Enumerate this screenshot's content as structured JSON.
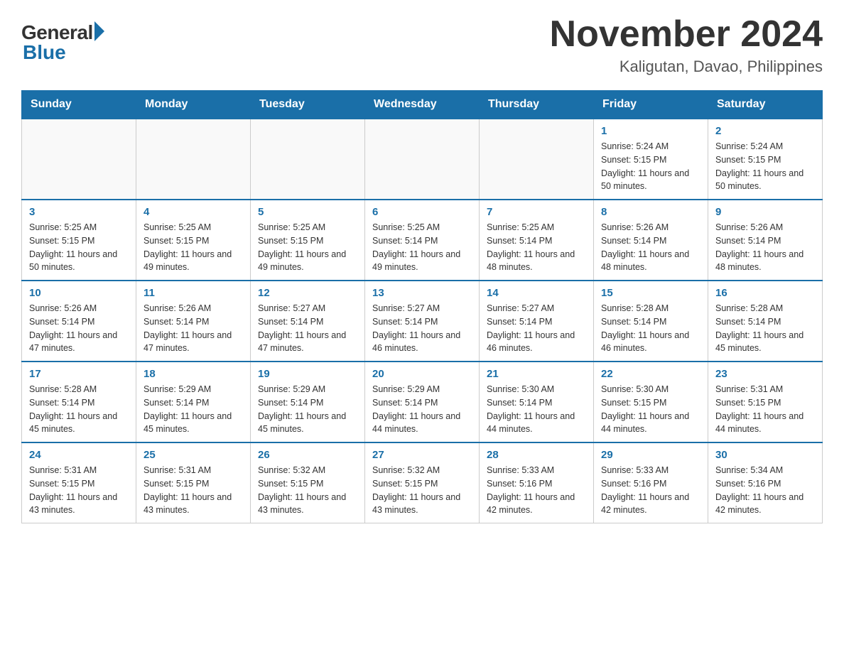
{
  "header": {
    "logo_general": "General",
    "logo_blue": "Blue",
    "month_year": "November 2024",
    "location": "Kaligutan, Davao, Philippines"
  },
  "days_of_week": [
    "Sunday",
    "Monday",
    "Tuesday",
    "Wednesday",
    "Thursday",
    "Friday",
    "Saturday"
  ],
  "weeks": [
    [
      {
        "day": "",
        "sunrise": "",
        "sunset": "",
        "daylight": ""
      },
      {
        "day": "",
        "sunrise": "",
        "sunset": "",
        "daylight": ""
      },
      {
        "day": "",
        "sunrise": "",
        "sunset": "",
        "daylight": ""
      },
      {
        "day": "",
        "sunrise": "",
        "sunset": "",
        "daylight": ""
      },
      {
        "day": "",
        "sunrise": "",
        "sunset": "",
        "daylight": ""
      },
      {
        "day": "1",
        "sunrise": "Sunrise: 5:24 AM",
        "sunset": "Sunset: 5:15 PM",
        "daylight": "Daylight: 11 hours and 50 minutes."
      },
      {
        "day": "2",
        "sunrise": "Sunrise: 5:24 AM",
        "sunset": "Sunset: 5:15 PM",
        "daylight": "Daylight: 11 hours and 50 minutes."
      }
    ],
    [
      {
        "day": "3",
        "sunrise": "Sunrise: 5:25 AM",
        "sunset": "Sunset: 5:15 PM",
        "daylight": "Daylight: 11 hours and 50 minutes."
      },
      {
        "day": "4",
        "sunrise": "Sunrise: 5:25 AM",
        "sunset": "Sunset: 5:15 PM",
        "daylight": "Daylight: 11 hours and 49 minutes."
      },
      {
        "day": "5",
        "sunrise": "Sunrise: 5:25 AM",
        "sunset": "Sunset: 5:15 PM",
        "daylight": "Daylight: 11 hours and 49 minutes."
      },
      {
        "day": "6",
        "sunrise": "Sunrise: 5:25 AM",
        "sunset": "Sunset: 5:14 PM",
        "daylight": "Daylight: 11 hours and 49 minutes."
      },
      {
        "day": "7",
        "sunrise": "Sunrise: 5:25 AM",
        "sunset": "Sunset: 5:14 PM",
        "daylight": "Daylight: 11 hours and 48 minutes."
      },
      {
        "day": "8",
        "sunrise": "Sunrise: 5:26 AM",
        "sunset": "Sunset: 5:14 PM",
        "daylight": "Daylight: 11 hours and 48 minutes."
      },
      {
        "day": "9",
        "sunrise": "Sunrise: 5:26 AM",
        "sunset": "Sunset: 5:14 PM",
        "daylight": "Daylight: 11 hours and 48 minutes."
      }
    ],
    [
      {
        "day": "10",
        "sunrise": "Sunrise: 5:26 AM",
        "sunset": "Sunset: 5:14 PM",
        "daylight": "Daylight: 11 hours and 47 minutes."
      },
      {
        "day": "11",
        "sunrise": "Sunrise: 5:26 AM",
        "sunset": "Sunset: 5:14 PM",
        "daylight": "Daylight: 11 hours and 47 minutes."
      },
      {
        "day": "12",
        "sunrise": "Sunrise: 5:27 AM",
        "sunset": "Sunset: 5:14 PM",
        "daylight": "Daylight: 11 hours and 47 minutes."
      },
      {
        "day": "13",
        "sunrise": "Sunrise: 5:27 AM",
        "sunset": "Sunset: 5:14 PM",
        "daylight": "Daylight: 11 hours and 46 minutes."
      },
      {
        "day": "14",
        "sunrise": "Sunrise: 5:27 AM",
        "sunset": "Sunset: 5:14 PM",
        "daylight": "Daylight: 11 hours and 46 minutes."
      },
      {
        "day": "15",
        "sunrise": "Sunrise: 5:28 AM",
        "sunset": "Sunset: 5:14 PM",
        "daylight": "Daylight: 11 hours and 46 minutes."
      },
      {
        "day": "16",
        "sunrise": "Sunrise: 5:28 AM",
        "sunset": "Sunset: 5:14 PM",
        "daylight": "Daylight: 11 hours and 45 minutes."
      }
    ],
    [
      {
        "day": "17",
        "sunrise": "Sunrise: 5:28 AM",
        "sunset": "Sunset: 5:14 PM",
        "daylight": "Daylight: 11 hours and 45 minutes."
      },
      {
        "day": "18",
        "sunrise": "Sunrise: 5:29 AM",
        "sunset": "Sunset: 5:14 PM",
        "daylight": "Daylight: 11 hours and 45 minutes."
      },
      {
        "day": "19",
        "sunrise": "Sunrise: 5:29 AM",
        "sunset": "Sunset: 5:14 PM",
        "daylight": "Daylight: 11 hours and 45 minutes."
      },
      {
        "day": "20",
        "sunrise": "Sunrise: 5:29 AM",
        "sunset": "Sunset: 5:14 PM",
        "daylight": "Daylight: 11 hours and 44 minutes."
      },
      {
        "day": "21",
        "sunrise": "Sunrise: 5:30 AM",
        "sunset": "Sunset: 5:14 PM",
        "daylight": "Daylight: 11 hours and 44 minutes."
      },
      {
        "day": "22",
        "sunrise": "Sunrise: 5:30 AM",
        "sunset": "Sunset: 5:15 PM",
        "daylight": "Daylight: 11 hours and 44 minutes."
      },
      {
        "day": "23",
        "sunrise": "Sunrise: 5:31 AM",
        "sunset": "Sunset: 5:15 PM",
        "daylight": "Daylight: 11 hours and 44 minutes."
      }
    ],
    [
      {
        "day": "24",
        "sunrise": "Sunrise: 5:31 AM",
        "sunset": "Sunset: 5:15 PM",
        "daylight": "Daylight: 11 hours and 43 minutes."
      },
      {
        "day": "25",
        "sunrise": "Sunrise: 5:31 AM",
        "sunset": "Sunset: 5:15 PM",
        "daylight": "Daylight: 11 hours and 43 minutes."
      },
      {
        "day": "26",
        "sunrise": "Sunrise: 5:32 AM",
        "sunset": "Sunset: 5:15 PM",
        "daylight": "Daylight: 11 hours and 43 minutes."
      },
      {
        "day": "27",
        "sunrise": "Sunrise: 5:32 AM",
        "sunset": "Sunset: 5:15 PM",
        "daylight": "Daylight: 11 hours and 43 minutes."
      },
      {
        "day": "28",
        "sunrise": "Sunrise: 5:33 AM",
        "sunset": "Sunset: 5:16 PM",
        "daylight": "Daylight: 11 hours and 42 minutes."
      },
      {
        "day": "29",
        "sunrise": "Sunrise: 5:33 AM",
        "sunset": "Sunset: 5:16 PM",
        "daylight": "Daylight: 11 hours and 42 minutes."
      },
      {
        "day": "30",
        "sunrise": "Sunrise: 5:34 AM",
        "sunset": "Sunset: 5:16 PM",
        "daylight": "Daylight: 11 hours and 42 minutes."
      }
    ]
  ]
}
